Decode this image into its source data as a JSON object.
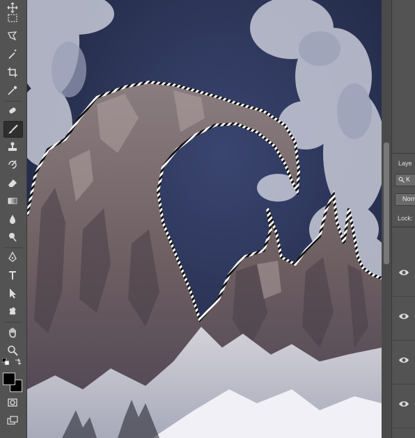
{
  "layers_panel": {
    "tab_label": "Laye",
    "filter_label": "K",
    "blend_mode": "Norm",
    "lock_label": "Lock:"
  },
  "tools": [
    "move",
    "marquee",
    "lasso",
    "magic-wand",
    "crop",
    "eyedropper",
    "healing",
    "brush",
    "clone-stamp",
    "history-brush",
    "eraser",
    "gradient",
    "blur",
    "dodge",
    "pen",
    "type",
    "path-selection",
    "shape",
    "hand",
    "zoom"
  ],
  "colors": {
    "foreground": "#000000",
    "background": "#000000",
    "sky": "#2c3455",
    "rock": "#7a6a6a",
    "snow": "#dfe0ea"
  }
}
